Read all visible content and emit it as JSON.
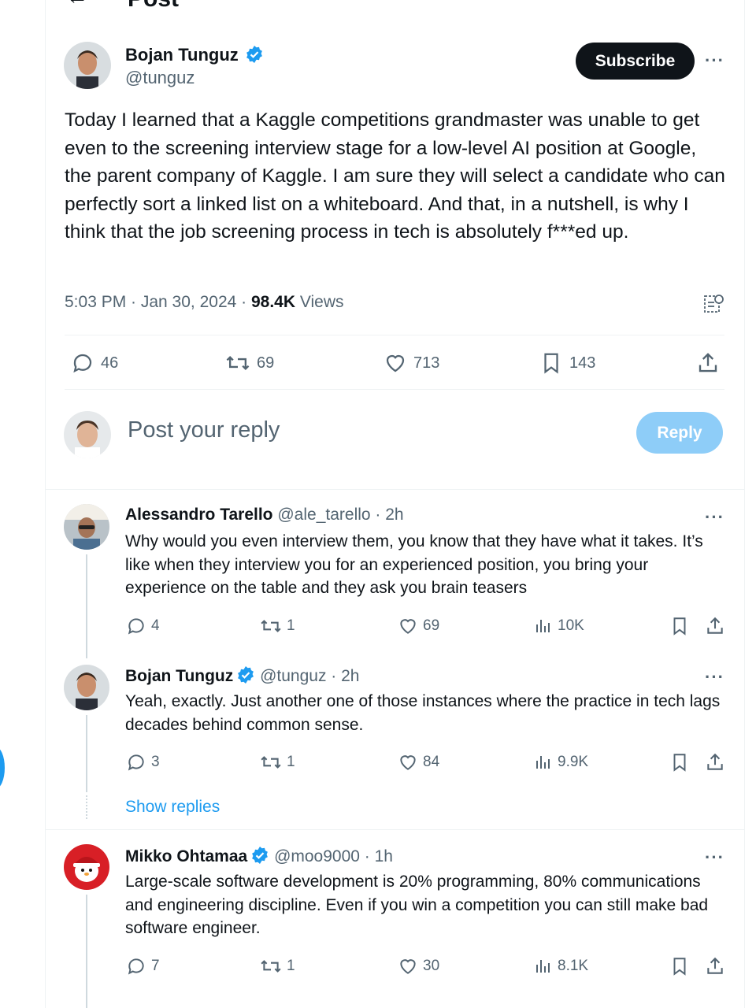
{
  "header": {
    "title": "Post"
  },
  "post": {
    "author_name": "Bojan Tunguz",
    "author_handle": "@tunguz",
    "subscribe_label": "Subscribe",
    "text": "Today I learned that a Kaggle competitions grandmaster was unable to get even to the screening interview stage for a low-level AI position at Google, the parent company of Kaggle. I am sure they will select a candidate who can perfectly sort a linked list on a whiteboard. And that, in a nutshell, is why I think that the job screening process in tech is absolutely f***ed up.",
    "time": "5:03 PM · Jan 30, 2024 · ",
    "views_count": "98.4K",
    "views_label": " Views",
    "replies": "46",
    "reposts": "69",
    "likes": "713",
    "bookmarks": "143"
  },
  "composer": {
    "placeholder": "Post your reply",
    "reply_label": "Reply"
  },
  "replies": [
    {
      "name": "Alessandro Tarello",
      "handle": "@ale_tarello",
      "time": " · 2h",
      "text": "Why would you even interview them, you know that they have what it takes. It’s like when they interview you for an experienced position, you bring your experience on the table and they ask you brain teasers",
      "replies": "4",
      "reposts": "1",
      "likes": "69",
      "views": "10K"
    },
    {
      "name": "Bojan Tunguz",
      "handle": "@tunguz",
      "time": " · 2h",
      "text": "Yeah, exactly. Just another one of those instances where the practice in tech lags decades behind common sense.",
      "replies": "3",
      "reposts": "1",
      "likes": "84",
      "views": "9.9K"
    },
    {
      "name": "Mikko Ohtamaa",
      "handle": "@moo9000",
      "time": " · 1h",
      "text": "Large-scale software development is 20% programming, 80% communications and engineering discipline. Even if you win a competition you can still make bad software engineer.",
      "replies": "7",
      "reposts": "1",
      "likes": "30",
      "views": "8.1K"
    }
  ],
  "show_replies_label": "Show replies",
  "colors": {
    "accent": "#1d9bf0",
    "text": "#0f1419",
    "muted": "#536471",
    "reply_button": "#8ecdf8"
  }
}
